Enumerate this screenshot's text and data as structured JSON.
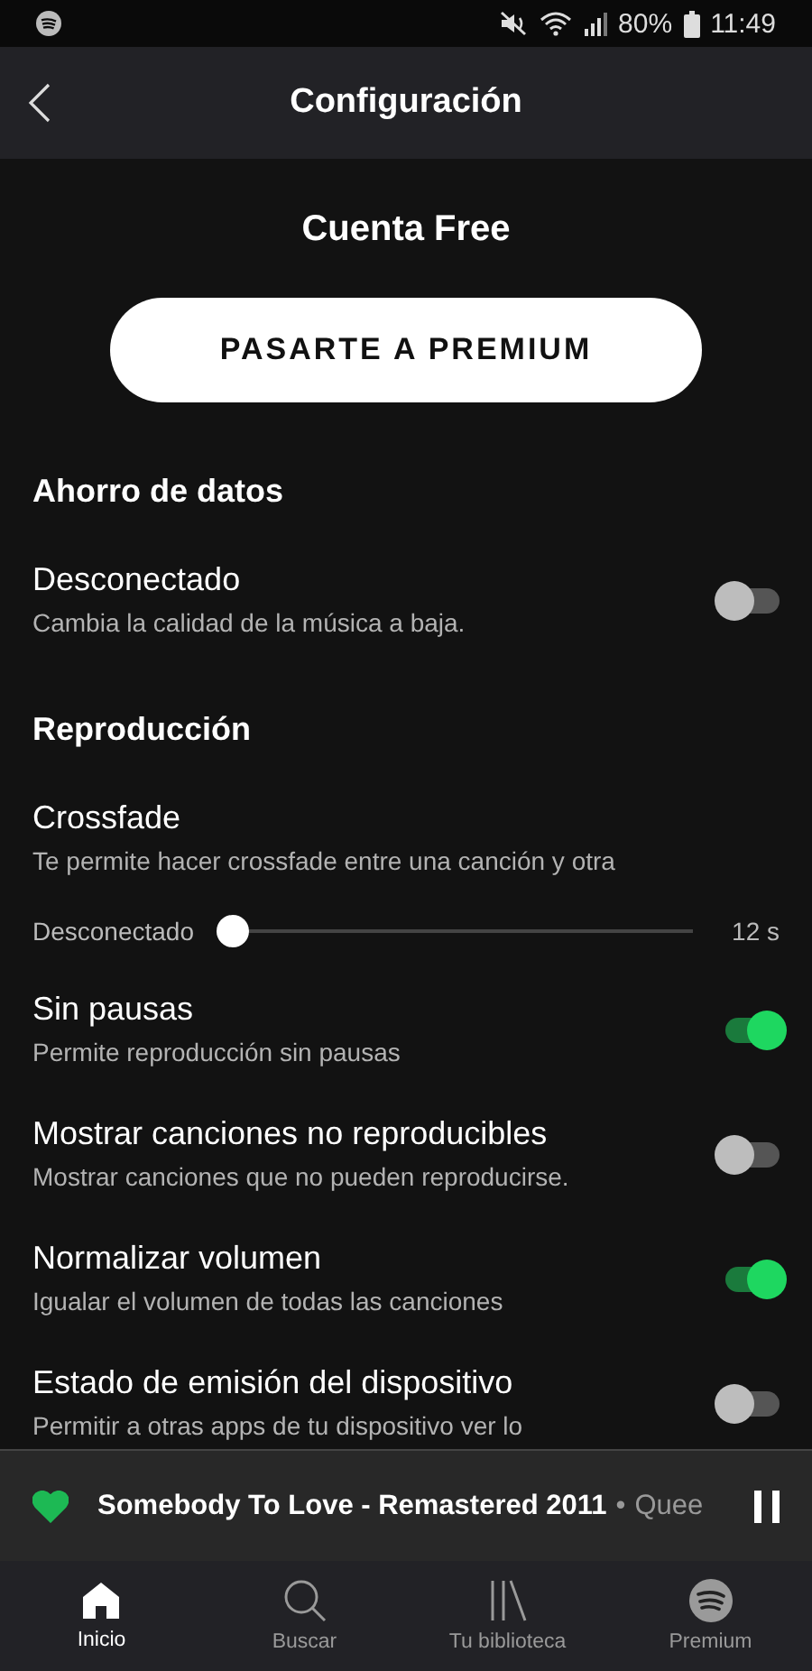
{
  "status_bar": {
    "battery": "80%",
    "time": "11:49"
  },
  "header": {
    "title": "Configuración"
  },
  "account": {
    "plan": "Cuenta Free",
    "upgrade_button": "PASARTE A PREMIUM"
  },
  "settings": [
    {
      "kind": "section",
      "title": "Ahorro de datos"
    },
    {
      "kind": "toggle",
      "title": "Desconectado",
      "description": "Cambia la calidad de la música a baja.",
      "on": false
    },
    {
      "kind": "section",
      "title": "Reproducción"
    },
    {
      "kind": "slider",
      "title": "Crossfade",
      "description": "Te permite hacer crossfade entre una canción y otra",
      "min_label": "Desconectado",
      "max_label": "12 s",
      "level": 0
    },
    {
      "kind": "toggle",
      "title": "Sin pausas",
      "description": "Permite reproducción sin pausas",
      "on": true
    },
    {
      "kind": "toggle",
      "title": "Mostrar canciones no reproducibles",
      "description": "Mostrar canciones que no pueden reproducirse.",
      "on": false
    },
    {
      "kind": "toggle",
      "title": "Normalizar volumen",
      "description": "Igualar el volumen de todas las canciones",
      "on": true
    },
    {
      "kind": "toggle",
      "title": "Estado de emisión del dispositivo",
      "description": "Permitir a otras apps de tu dispositivo ver lo",
      "on": false
    }
  ],
  "player": {
    "title": "Somebody To Love - Remastered 2011",
    "separator": "•",
    "artist": "Quee",
    "liked": true
  },
  "nav": [
    {
      "kind": "home",
      "label": "Inicio",
      "selected": true
    },
    {
      "kind": "search",
      "label": "Buscar",
      "selected": false
    },
    {
      "kind": "library",
      "label": "Tu biblioteca",
      "selected": false
    },
    {
      "kind": "premium",
      "label": "Premium",
      "selected": false
    }
  ]
}
